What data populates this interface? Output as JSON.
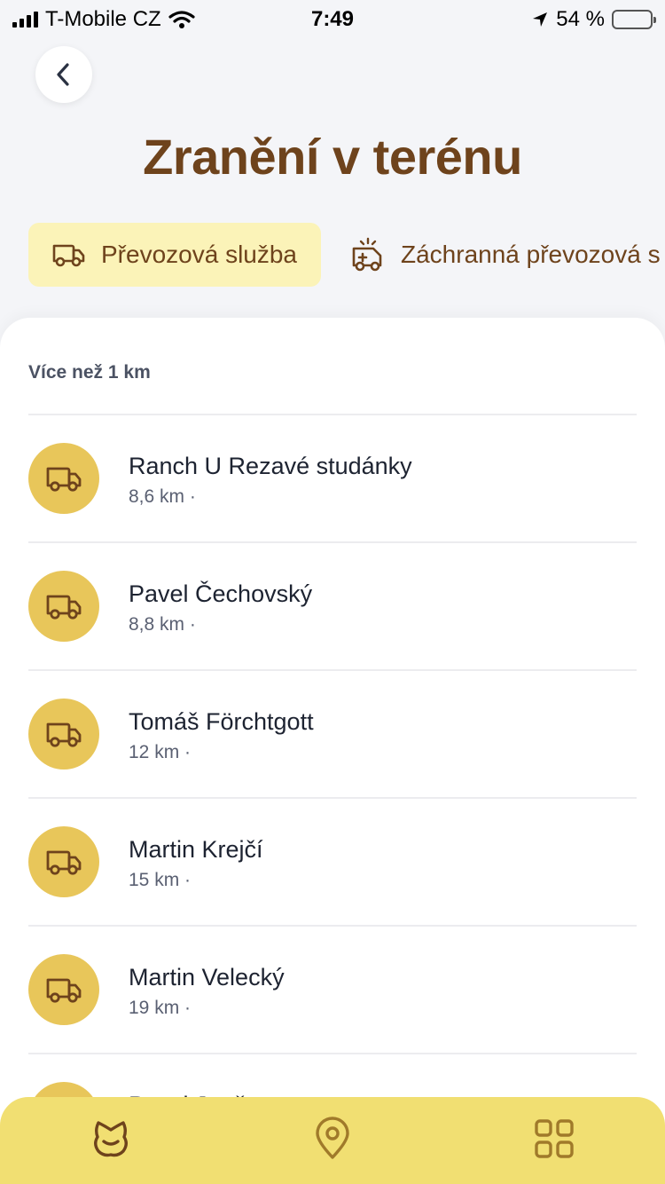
{
  "status": {
    "carrier": "T-Mobile CZ",
    "time": "7:49",
    "battery": "54 %"
  },
  "header": {
    "title": "Zranění v terénu"
  },
  "chips": [
    {
      "label": "Převozová služba",
      "active": true
    },
    {
      "label": "Záchranná převozová s",
      "active": false
    }
  ],
  "section": {
    "label": "Více než 1 km"
  },
  "items": [
    {
      "name": "Ranch U Rezavé studánky",
      "distance": "8,6 km ·"
    },
    {
      "name": "Pavel Čechovský",
      "distance": "8,8 km ·"
    },
    {
      "name": "Tomáš Förchtgott",
      "distance": "12 km ·"
    },
    {
      "name": "Martin Krejčí",
      "distance": "15 km ·"
    },
    {
      "name": "Martin Velecký",
      "distance": "19 km ·"
    },
    {
      "name": "Pavel Janč",
      "distance": ""
    }
  ],
  "colors": {
    "brown": "#6e431c",
    "avatar_yellow": "#e8c65a",
    "chip_active": "#fbf3b8",
    "tabbar": "#f1df72"
  },
  "tabbar": [
    {
      "icon": "pet-icon"
    },
    {
      "icon": "location-pin-icon"
    },
    {
      "icon": "grid-icon"
    }
  ]
}
